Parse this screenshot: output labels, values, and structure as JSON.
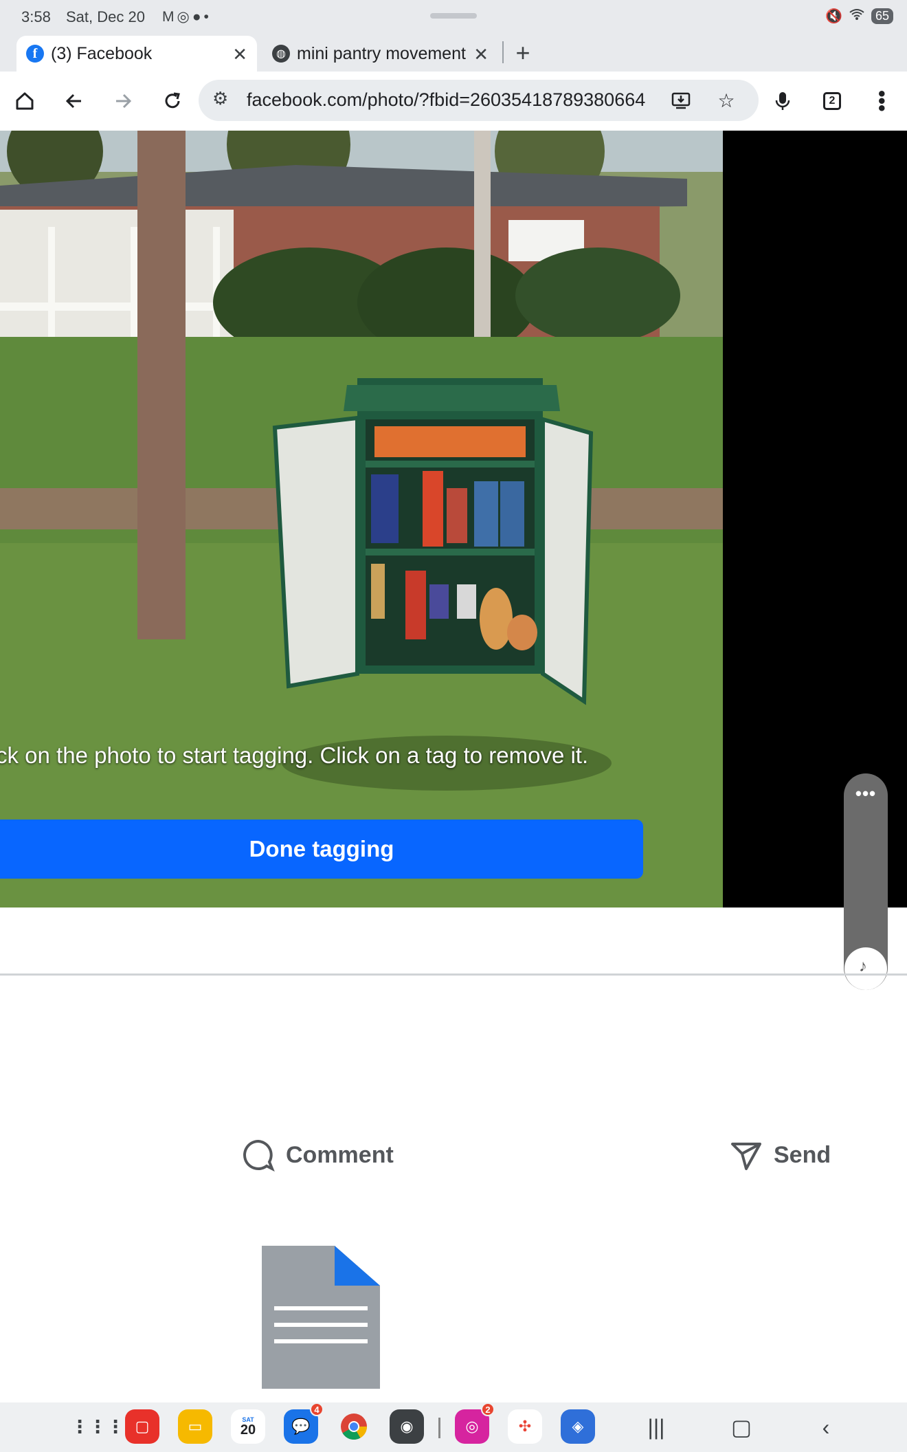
{
  "status_bar": {
    "time": "3:58",
    "date": "Sat, Dec 20",
    "left_icons": [
      "gmail-icon",
      "instagram-icon",
      "messages-icon",
      "dot-icon"
    ],
    "battery": "65"
  },
  "tabs": [
    {
      "title": "(3) Facebook",
      "favicon": "facebook-icon",
      "active": true
    },
    {
      "title": "mini pantry movement",
      "favicon": "globe-icon",
      "active": false
    }
  ],
  "toolbar": {
    "url": "facebook.com/photo/?fbid=26035418789380664",
    "tab_count": "2"
  },
  "photo": {
    "tag_hint": "ck on the photo to start tagging. Click on a tag to remove it.",
    "done_label": "Done tagging",
    "side_pill_dots": "•••"
  },
  "actions": {
    "comment_label": "Comment",
    "send_label": "Send"
  },
  "dock": {
    "apps": [
      {
        "name": "app-drawer-icon"
      },
      {
        "name": "notes-app-icon"
      },
      {
        "name": "files-app-icon"
      },
      {
        "name": "calendar-app-icon",
        "day": "SAT",
        "date": "20"
      },
      {
        "name": "messages-app-icon",
        "badge": "4"
      },
      {
        "name": "chrome-app-icon"
      },
      {
        "name": "camera-app-icon"
      },
      {
        "name": "instagram-app-icon",
        "badge": "2"
      },
      {
        "name": "photos-app-icon"
      },
      {
        "name": "store-app-icon"
      }
    ]
  },
  "colors": {
    "facebook_blue": "#0866ff",
    "chrome_bar": "#e8eaed"
  }
}
